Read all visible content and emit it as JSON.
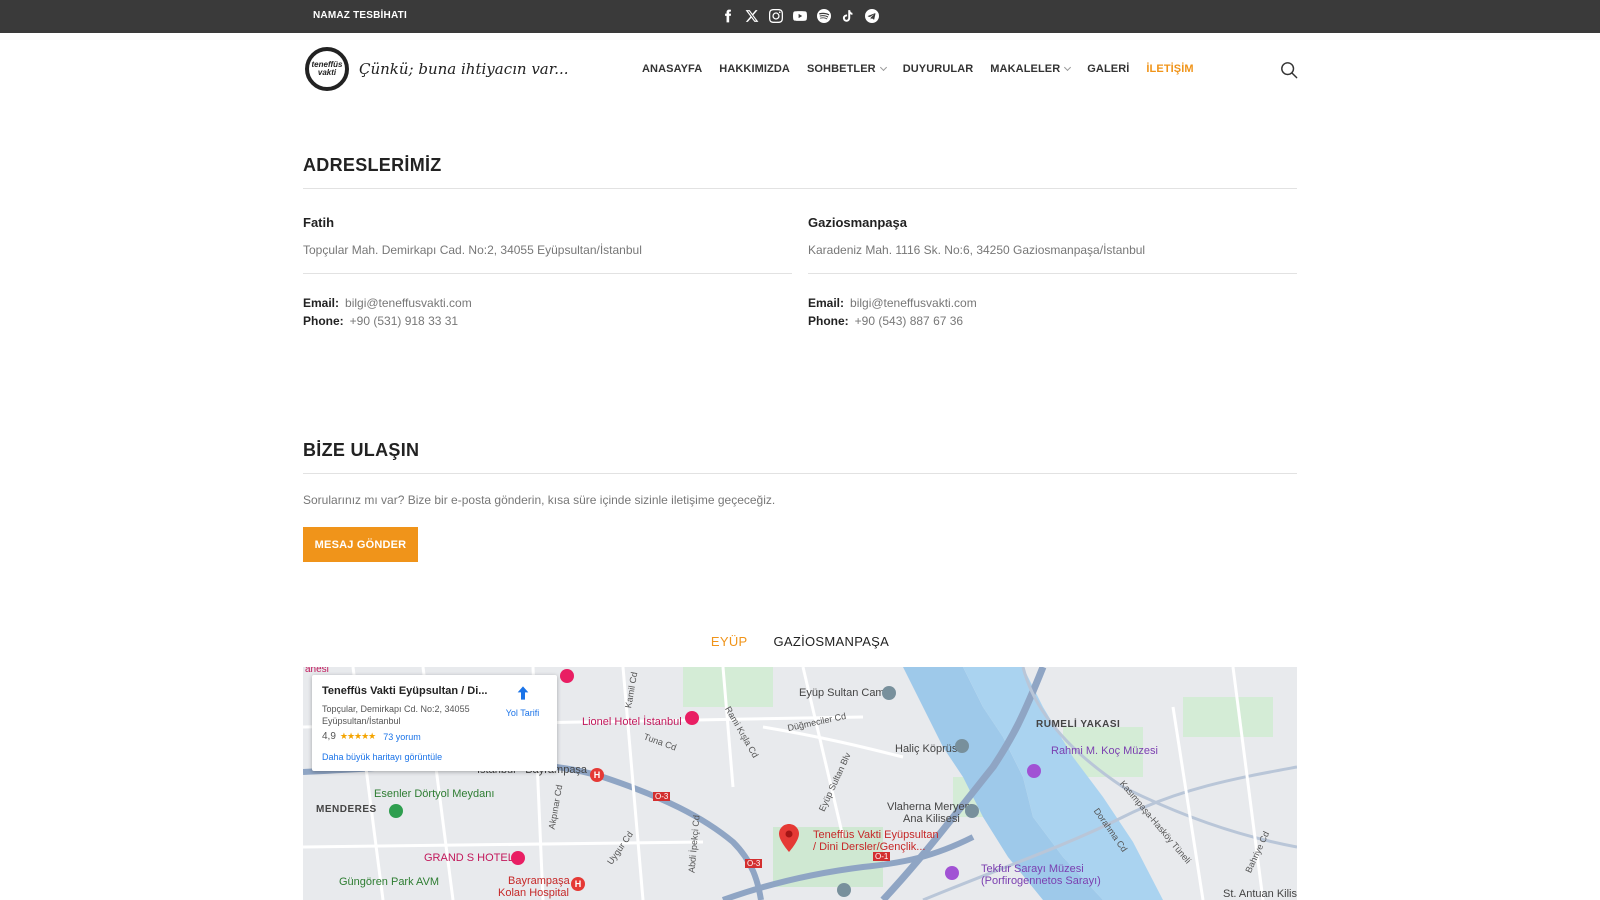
{
  "topbar": {
    "left_link": "NAMAZ TESBİHATI",
    "social": [
      "facebook-icon",
      "x-icon",
      "instagram-icon",
      "youtube-icon",
      "spotify-icon",
      "tiktok-icon",
      "telegram-icon"
    ]
  },
  "header": {
    "logo_text": "teneffüs vakti",
    "tagline": "Çünkü; buna ihtiyacın var...",
    "nav": [
      {
        "label": "ANASAYFA",
        "dropdown": false,
        "active": false
      },
      {
        "label": "HAKKIMIZDA",
        "dropdown": false,
        "active": false
      },
      {
        "label": "SOHBETLER",
        "dropdown": true,
        "active": false
      },
      {
        "label": "DUYURULAR",
        "dropdown": false,
        "active": false
      },
      {
        "label": "MAKALELER",
        "dropdown": true,
        "active": false
      },
      {
        "label": "GALERİ",
        "dropdown": false,
        "active": false
      },
      {
        "label": "İLETİŞİM",
        "dropdown": false,
        "active": true
      }
    ]
  },
  "addresses": {
    "title": "ADRESLERİMİZ",
    "items": [
      {
        "name": "Fatih",
        "address": "Topçular Mah. Demirkapı Cad. No:2, 34055 Eyüpsultan/İstanbul",
        "email_label": "Email:",
        "email": "bilgi@teneffusvakti.com",
        "phone_label": "Phone:",
        "phone": "+90 (531) 918 33 31"
      },
      {
        "name": "Gaziosmanpaşa",
        "address": "Karadeniz Mah. 1116 Sk. No:6, 34250 Gaziosmanpaşa/İstanbul",
        "email_label": "Email:",
        "email": "bilgi@teneffusvakti.com",
        "phone_label": "Phone:",
        "phone": "+90 (543) 887 67 36"
      }
    ]
  },
  "contact": {
    "title": "BİZE ULAŞIN",
    "description": "Sorularınız mı var? Bize bir e-posta gönderin, kısa süre içinde sizinle iletişime geçeceğiz.",
    "button": "MESAJ GÖNDER"
  },
  "map_tabs": [
    {
      "label": "EYÜP",
      "active": true
    },
    {
      "label": "GAZİOSMANPAŞA",
      "active": false
    }
  ],
  "map": {
    "card": {
      "title": "Teneffüs Vakti Eyüpsultan / Di...",
      "address": "Topçular, Demirkapı Cd. No:2, 34055 Eyüpsultan/İstanbul",
      "rating": "4,9",
      "stars": "★★★★★",
      "reviews": "73 yorum",
      "larger_map": "Daha büyük haritayı görüntüle",
      "directions": "Yol Tarifi"
    },
    "labels": {
      "eyup_camii": "Eyüp Sultan Camii",
      "lionel": "Lionel Hotel İstanbul",
      "halic": "Haliç Köprüsü",
      "rumeli": "RUMELİ YAKASI",
      "rahmi": "Rahmi M. Koç Müzesi",
      "esenler": "Esenler Dörtyol Meydanı",
      "menderes": "MENDERES",
      "istanbul_bayrampasa": "İstanbul - Bayrampaşa",
      "vlaherna": "Vlaherna Meryem",
      "ana_kilisesi": "Ana Kilisesi",
      "pin_label_1": "Teneffüs Vakti Eyüpsultan",
      "pin_label_2": "/ Dini Dersler/Gençlik...",
      "grand_s": "GRAND S HOTEL",
      "tekfur_1": "Tekfur Sarayı Müzesi",
      "tekfur_2": "(Porfirogennetos Sarayı)",
      "gungoren": "Güngören Park AVM",
      "bayrampasa_kolan_1": "Bayrampaşa",
      "bayrampasa_kolan_2": "Kolan Hospital",
      "st_antuan": "St. Antuan Kilis",
      "duğmeciler": "Düğmeciler Cd",
      "tuna": "Tuna Cd",
      "rami_kisla": "Rami Kışla Cd",
      "eyup_sultan_blv": "Eyüp Sultan Blv",
      "kamil": "Kamil Cd",
      "akpinar": "Akpınar Cd",
      "uygur": "Uygur Cd",
      "abdi_ipekci": "Abdi İpekçi Cd",
      "kasimpasa": "Kasımpaşa-Hasköy Tüneli",
      "dorahma": "Dorahma Cd",
      "bahriye": "Bahriye Cd",
      "o3a": "O-3",
      "o3b": "O-3",
      "o1": "O-1",
      "anesi": "anesi"
    }
  }
}
